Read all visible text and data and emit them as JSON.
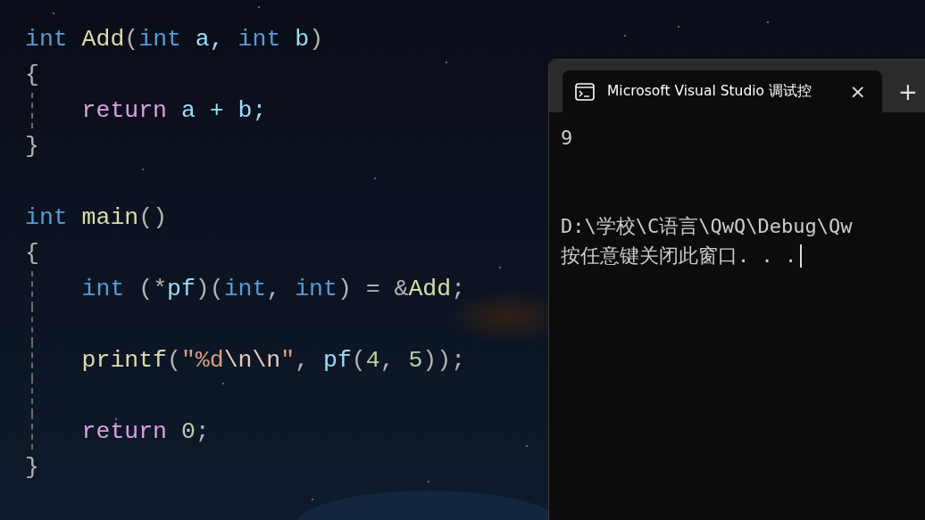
{
  "editor": {
    "lines": [
      {
        "guide": false,
        "tokens": [
          {
            "text": "int",
            "kind": "keyword"
          },
          {
            "text": " Add",
            "kind": "function"
          },
          {
            "text": "(",
            "kind": "punct"
          },
          {
            "text": "int",
            "kind": "keyword"
          },
          {
            "text": " a, ",
            "kind": "param"
          },
          {
            "text": "int",
            "kind": "keyword"
          },
          {
            "text": " b",
            "kind": "param"
          },
          {
            "text": ")",
            "kind": "punct"
          }
        ]
      },
      {
        "guide": false,
        "tokens": [
          {
            "text": "{",
            "kind": "punct"
          }
        ]
      },
      {
        "guide": true,
        "tokens": [
          {
            "text": "    return",
            "kind": "control"
          },
          {
            "text": " a + b;",
            "kind": "param"
          }
        ]
      },
      {
        "guide": false,
        "tokens": [
          {
            "text": "}",
            "kind": "punct"
          }
        ]
      },
      {
        "guide": false
      },
      {
        "guide": false,
        "tokens": [
          {
            "text": "int",
            "kind": "keyword"
          },
          {
            "text": " main",
            "kind": "function"
          },
          {
            "text": "()",
            "kind": "punct"
          }
        ]
      },
      {
        "guide": false,
        "tokens": [
          {
            "text": "{",
            "kind": "punct"
          }
        ]
      },
      {
        "guide": true,
        "tokens": [
          {
            "text": "    int",
            "kind": "keyword"
          },
          {
            "text": " (*",
            "kind": "punct"
          },
          {
            "text": "pf",
            "kind": "param"
          },
          {
            "text": ")(",
            "kind": "punct"
          },
          {
            "text": "int",
            "kind": "keyword"
          },
          {
            "text": ", ",
            "kind": "punct"
          },
          {
            "text": "int",
            "kind": "keyword"
          },
          {
            "text": ") = &",
            "kind": "punct"
          },
          {
            "text": "Add",
            "kind": "function"
          },
          {
            "text": ";",
            "kind": "punct"
          }
        ]
      },
      {
        "guide": true
      },
      {
        "guide": true,
        "tokens": [
          {
            "text": "    printf",
            "kind": "function"
          },
          {
            "text": "(",
            "kind": "punct"
          },
          {
            "text": "\"%d",
            "kind": "string"
          },
          {
            "text": "\\n\\n",
            "kind": "escape"
          },
          {
            "text": "\"",
            "kind": "string"
          },
          {
            "text": ", ",
            "kind": "punct"
          },
          {
            "text": "pf",
            "kind": "param"
          },
          {
            "text": "(",
            "kind": "punct"
          },
          {
            "text": "4",
            "kind": "number"
          },
          {
            "text": ", ",
            "kind": "punct"
          },
          {
            "text": "5",
            "kind": "number"
          },
          {
            "text": "));",
            "kind": "punct"
          }
        ]
      },
      {
        "guide": true
      },
      {
        "guide": true,
        "tokens": [
          {
            "text": "    return",
            "kind": "control"
          },
          {
            "text": " 0",
            "kind": "number"
          },
          {
            "text": ";",
            "kind": "punct"
          }
        ]
      },
      {
        "guide": false,
        "tokens": [
          {
            "text": "}",
            "kind": "punct"
          }
        ]
      }
    ]
  },
  "terminal": {
    "tabs": [
      {
        "title": "Microsoft Visual Studio 调试控",
        "selected": true,
        "close": "×"
      }
    ],
    "new_tab": "+",
    "output": [
      {
        "kind": "text",
        "text": "9"
      },
      {
        "kind": "blank"
      },
      {
        "kind": "blank"
      },
      {
        "kind": "text",
        "text": "D:\\学校\\C语言\\QwQ\\Debug\\Qw"
      },
      {
        "kind": "text",
        "text": "按任意键关闭此窗口. . ."
      }
    ],
    "cursor": true
  }
}
